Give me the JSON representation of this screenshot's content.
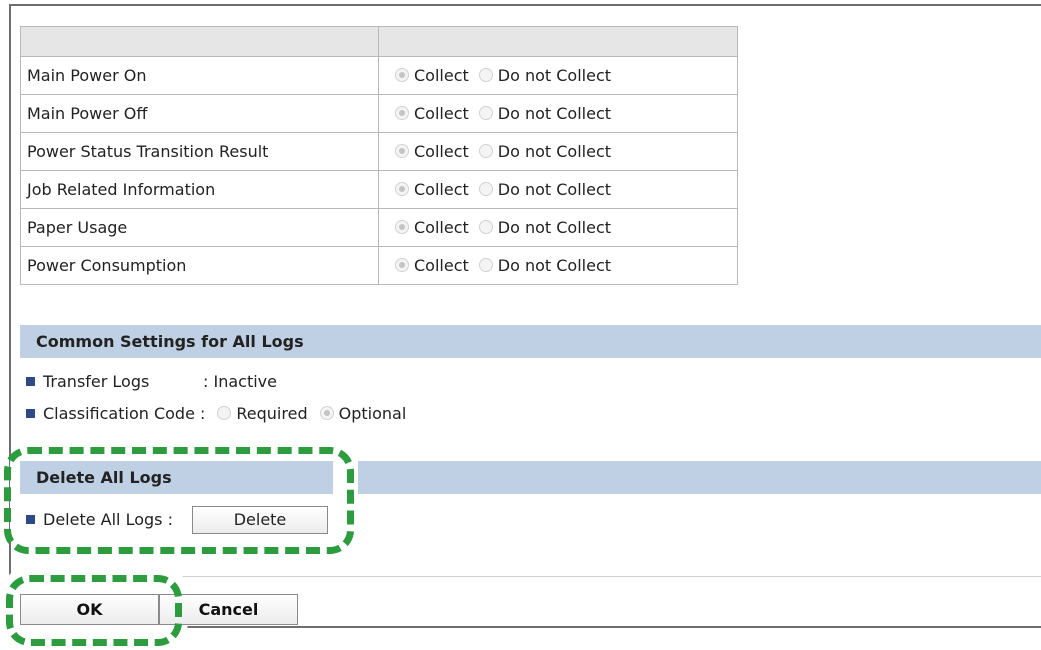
{
  "log_table": {
    "header": [
      "",
      ""
    ],
    "rows": [
      {
        "name": "Main Power On",
        "collect": "Collect",
        "not_collect": "Do not Collect",
        "selected": "collect"
      },
      {
        "name": "Main Power Off",
        "collect": "Collect",
        "not_collect": "Do not Collect",
        "selected": "collect"
      },
      {
        "name": "Power Status Transition Result",
        "collect": "Collect",
        "not_collect": "Do not Collect",
        "selected": "collect"
      },
      {
        "name": "Job Related Information",
        "collect": "Collect",
        "not_collect": "Do not Collect",
        "selected": "collect"
      },
      {
        "name": "Paper Usage",
        "collect": "Collect",
        "not_collect": "Do not Collect",
        "selected": "collect"
      },
      {
        "name": "Power Consumption",
        "collect": "Collect",
        "not_collect": "Do not Collect",
        "selected": "collect"
      }
    ]
  },
  "common_settings": {
    "title": "Common Settings for All Logs",
    "transfer_logs_label": "Transfer Logs",
    "transfer_logs_value": ": Inactive",
    "classification_label": "Classification Code :",
    "classification_required": "Required",
    "classification_optional": "Optional",
    "classification_selected": "optional"
  },
  "delete_all": {
    "title": "Delete All Logs",
    "label": "Delete All Logs :",
    "button": "Delete"
  },
  "footer": {
    "ok": "OK",
    "cancel": "Cancel"
  },
  "colors": {
    "section_bar": "#c0d0e4",
    "highlight": "#2c9c3f",
    "bullet": "#2e4a86"
  }
}
